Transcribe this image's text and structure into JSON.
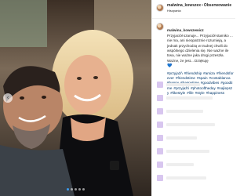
{
  "header": {
    "username": "malwina_kowszex",
    "separator": "•",
    "follow_label": "Obserwowanie",
    "location": "Hiszpania"
  },
  "caption": {
    "username": "malwina_kowszewicz",
    "text": "Przyjaciół szanuje... Przyjaciół stamiko ... nie ma, ani nieopatrznie rozumieją, a jednak przychodzą w trudnej chwili do wspólnego dzielenia się. Nie ważne ile trwa, nie ważne jaka drogi przeszła. Ważne, że jest... Dziękuję",
    "heart": "💙",
    "hashtags": [
      "#przyjaźń",
      "#friendship",
      "#amiza",
      "#friendsforever",
      "#friendstime",
      "#spain",
      "#costablanca",
      "#happy",
      "#happytime",
      "#goodvibes",
      "#goodtime",
      "#przyjaźń",
      "#photooftheday",
      "#najlepszy",
      "#likestyle",
      "#life",
      "#style",
      "#happiness"
    ]
  },
  "comments": [
    {
      "bar_fraction": 0.55
    },
    {
      "bar_fraction": 0.75
    },
    {
      "bar_fraction": 0.6
    },
    {
      "bar_fraction": 0.8
    },
    {
      "bar_fraction": 0.5
    },
    {
      "bar_fraction": 0.7
    },
    {
      "bar_fraction": 0.45
    },
    {
      "bar_fraction": 0.65
    }
  ],
  "carousel": {
    "prev_icon": "chevron-left-icon",
    "prev_glyph": "‹",
    "slide_count": 5,
    "active_index": 0
  },
  "colors": {
    "accent": "#3b9cf0",
    "hashtag": "#00376b",
    "placeholder_avatar": "#d8c6ef"
  }
}
